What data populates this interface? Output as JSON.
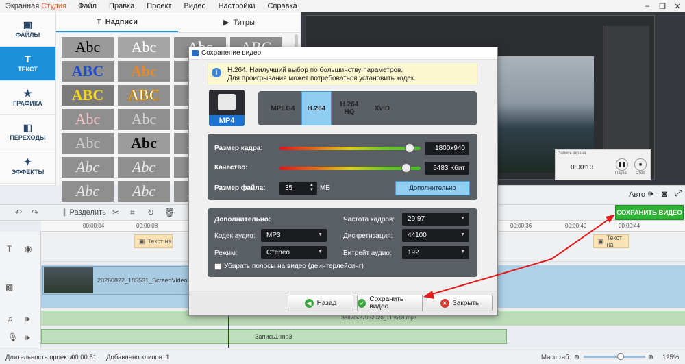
{
  "app": {
    "title_prefix": "Экранная ",
    "title_accent": "Студия"
  },
  "menu": [
    "Файл",
    "Правка",
    "Проект",
    "Видео",
    "Настройки",
    "Справка"
  ],
  "nav": [
    {
      "label": "ФАЙЛЫ",
      "icon": "▣"
    },
    {
      "label": "ТЕКСТ",
      "icon": "T"
    },
    {
      "label": "ГРАФИКА",
      "icon": "★"
    },
    {
      "label": "ПЕРЕХОДЫ",
      "icon": "◧"
    },
    {
      "label": "ЭФФЕКТЫ",
      "icon": "✦"
    }
  ],
  "tabs": {
    "captions": "Надписи",
    "titles": "Титры"
  },
  "styles": [
    "Abc",
    "Abc",
    "Abc",
    "ABC",
    "ABC",
    "Abc",
    "Abc",
    "ABC",
    "ABC",
    "ABC",
    "Abc",
    "Abc",
    "Abc",
    "Abc",
    "Abc",
    "Abc",
    "Abc",
    "Abc",
    "Abc",
    "Abc",
    "Abc",
    "Abc",
    "Abc",
    "Abc",
    "Abc",
    "Abc",
    "Abc",
    "Abc"
  ],
  "recorder": {
    "title": "Запись экрана",
    "time": "0:00:13",
    "pause": "Пауза",
    "stop": "Стоп"
  },
  "player": {
    "auto": "Авто"
  },
  "toolbar": {
    "split": "Разделить",
    "save_video": "СОХРАНИТЬ ВИДЕО"
  },
  "ruler": [
    "00:00:04",
    "00:00:08",
    "00:00:36",
    "00:00:40",
    "00:00:44"
  ],
  "timeline": {
    "text_clip": "Текст на",
    "video_clip": "20260822_185531_ScreenVideo.mp4",
    "audio1": "Запись27052026_113618.mp3",
    "audio2": "Запись1.mp3"
  },
  "status": {
    "duration_label": "Длительность проекта:",
    "duration": "00:00:51",
    "clips": "Добавлено клипов: 1",
    "zoom_label": "Масштаб:",
    "zoom": "125%",
    "zoom_level": 0.6
  },
  "dialog": {
    "title": "Сохранение видео",
    "info_line1": "H.264. Наилучший выбор по большинству параметров.",
    "info_line2": "Для проигрывания может потребоваться установить кодек.",
    "format": "MP4",
    "codecs": [
      "MPEG4",
      "H.264",
      "H.264 HQ",
      "XviD"
    ],
    "selected_codec": "H.264",
    "frame_size_label": "Размер кадра:",
    "frame_size": "1800x940",
    "frame_size_level": 0.92,
    "quality_label": "Качество:",
    "quality": "5483 Кбит",
    "quality_level": 0.9,
    "file_size_label": "Размер файла:",
    "file_size": "35",
    "file_size_unit": "МБ",
    "more_button": "Дополнительно",
    "advanced_title": "Дополнительно:",
    "audio_codec_label": "Кодек аудио:",
    "audio_codec": "MP3",
    "mode_label": "Режим:",
    "mode": "Стерео",
    "fps_label": "Частота кадров:",
    "fps": "29.97",
    "sample_rate_label": "Дискретизация:",
    "sample_rate": "44100",
    "bitrate_label": "Битрейт аудио:",
    "bitrate": "192",
    "deinterlace": "Убирать полосы на видео (деинтерлейсинг)",
    "back": "Назад",
    "save": "Сохранить видео",
    "close": "Закрыть"
  },
  "colors": {
    "accent": "#1e8fd9",
    "save_green": "#2eb135",
    "arrow_red": "#e21b1b"
  }
}
